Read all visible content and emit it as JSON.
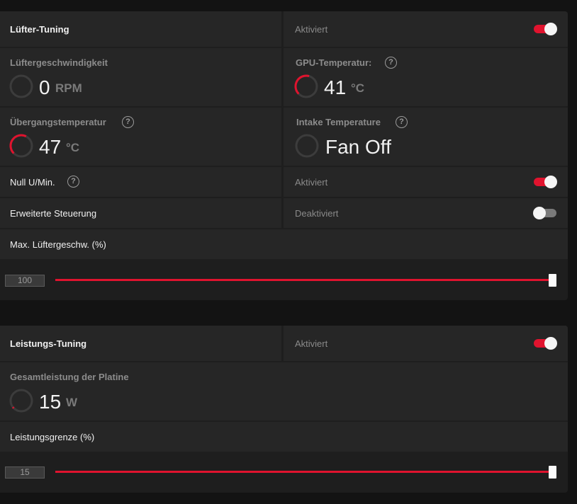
{
  "fan_tuning": {
    "title": "Lüfter-Tuning",
    "status": "Aktiviert",
    "enabled": true,
    "fan_speed": {
      "label": "Lüftergeschwindigkeit",
      "value": "0",
      "unit": "RPM",
      "level": 0
    },
    "gpu_temp": {
      "label": "GPU-Temperatur:",
      "value": "41",
      "unit": "°C",
      "level": 0.41
    },
    "junction_temp": {
      "label": "Übergangstemperatur",
      "value": "47",
      "unit": "°C",
      "level": 0.47
    },
    "intake_temp": {
      "label": "Intake Temperature",
      "value": "Fan Off",
      "level": 0
    },
    "zero_rpm": {
      "label": "Null U/Min.",
      "status": "Aktiviert",
      "enabled": true
    },
    "advanced_control": {
      "label": "Erweiterte Steuerung",
      "status": "Deaktiviert",
      "enabled": false
    },
    "max_fan_speed": {
      "label": "Max. Lüftergeschw. (%)",
      "value": "100",
      "fraction": 1.0
    }
  },
  "power_tuning": {
    "title": "Leistungs-Tuning",
    "status": "Aktiviert",
    "enabled": true,
    "board_power": {
      "label": "Gesamtleistung der Platine",
      "value": "15",
      "unit": "W",
      "level": 0.04
    },
    "power_limit": {
      "label": "Leistungsgrenze (%)",
      "value": "15",
      "fraction": 1.0
    }
  },
  "colors": {
    "accent": "#e0132e",
    "gauge_track": "#3c3c3c"
  },
  "icons": {
    "help": "question-circle-icon"
  }
}
